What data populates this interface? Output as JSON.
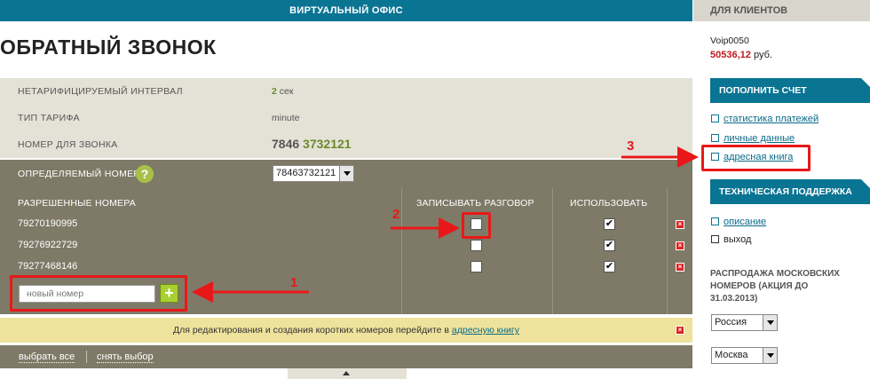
{
  "topbar": {
    "title": "ВИРТУАЛЬНЫЙ ОФИС"
  },
  "page": {
    "title": "ОБРАТНЫЙ ЗВОНОК"
  },
  "info": {
    "interval_label": "НЕТАРИФИЦИРУЕМЫЙ ИНТЕРВАЛ",
    "interval_value": "2",
    "interval_unit": "сек",
    "tariff_label": "ТИП ТАРИФА",
    "tariff_value": "minute",
    "callnum_label": "НОМЕР ДЛЯ ЗВОНКА",
    "callnum_prefix": "7846",
    "callnum_number": "3732121"
  },
  "detect": {
    "label": "ОПРЕДЕЛЯЕМЫЙ НОМЕР",
    "help_icon": "?",
    "selected": "78463732121"
  },
  "table": {
    "headers": {
      "numbers": "РАЗРЕШЕННЫЕ НОМЕРА",
      "record": "ЗАПИСЫВАТЬ РАЗГОВОР",
      "use": "ИСПОЛЬЗОВАТЬ"
    },
    "rows": [
      {
        "number": "79270190995",
        "record": false,
        "use": true
      },
      {
        "number": "79276922729",
        "record": false,
        "use": true
      },
      {
        "number": "79277468146",
        "record": false,
        "use": true
      }
    ],
    "new_placeholder": "новый номер",
    "add_icon": "+",
    "delete_icon": "×"
  },
  "infobar": {
    "text": "Для редактирования и создания коротких номеров перейдите в",
    "link": "адресную книгу"
  },
  "bottom": {
    "select_all": "выбрать все",
    "clear": "снять выбор"
  },
  "annotations": {
    "one": "1",
    "two": "2",
    "three": "3"
  },
  "sidebar": {
    "header": "ДЛЯ КЛИЕНТОВ",
    "login": "Voip0050",
    "balance": "50536,12",
    "currency": "руб.",
    "topup": "ПОПОЛНИТЬ СЧЕТ",
    "links1": [
      "статистика платежей",
      "личные данные",
      "адресная книга"
    ],
    "support": "ТЕХНИЧЕСКАЯ ПОДДЕРЖКА",
    "links2": [
      "описание",
      "выход"
    ],
    "sale": "РАСПРОДАЖА МОСКОВСКИХ НОМЕРОВ (АКЦИЯ ДО 31.03.2013)",
    "country": "Россия",
    "city": "Москва"
  },
  "colors": {
    "brand": "#0a7493",
    "olive": "#7e7a67",
    "annotation": "#e81818",
    "balance": "#c0191f"
  }
}
